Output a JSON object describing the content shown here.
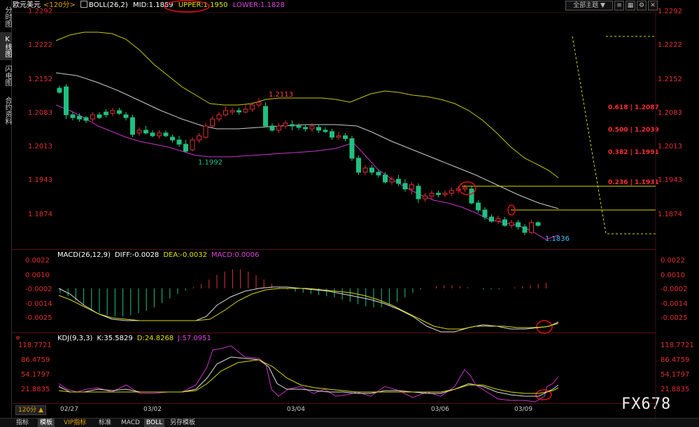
{
  "sidebar": {
    "items": [
      {
        "label": "分时图",
        "active": false
      },
      {
        "label": "K线图",
        "active": true
      },
      {
        "label": "闪电图",
        "active": false
      },
      {
        "label": "合约资料",
        "active": false
      }
    ]
  },
  "header": {
    "symbol": "欧元美元",
    "period": "<120分>",
    "boll_label": "BOLL(26,2)",
    "mid": "MID:1.1889",
    "upper": "UPPER:1.1950",
    "lower": "LOWER:1.1828",
    "theme_button": "全部主题",
    "theme_arrow": "▼"
  },
  "colors": {
    "upper_band": "#c8c800",
    "mid_band": "#cccccc",
    "lower_band": "#cc33cc",
    "up_candle": "#e03030",
    "down_candle": "#20c080",
    "axis_text": "#e03030",
    "fib_text": "#ff3030",
    "annotation_circle": "#e01010"
  },
  "price_axis": [
    "1.2292",
    "1.2222",
    "1.2152",
    "1.2083",
    "1.2013",
    "1.1943",
    "1.1874"
  ],
  "price_annotations": {
    "high": "1.2113",
    "low1": "1.1992",
    "low2": "1.1836"
  },
  "fibonacci": [
    {
      "label": "0.618 | 1.2087"
    },
    {
      "label": "0.500 | 1.2039"
    },
    {
      "label": "0.382 | 1.1991"
    },
    {
      "label": "0.236 | 1.1931"
    }
  ],
  "macd": {
    "title": "MACD(26,12,9)",
    "diff": "DIFF:-0.0028",
    "dea": "DEA:-0.0032",
    "macd": "MACD:0.0006",
    "axis": [
      "0.0022",
      "0.0010",
      "-0.0002",
      "-0.0014",
      "-0.0025"
    ]
  },
  "kdj": {
    "title": "KDJ(9,3,3)",
    "k": "K:35.5829",
    "d": "D:24.8268",
    "j": "J:57.0951",
    "axis": [
      "118.7721",
      "86.4759",
      "54.1797",
      "21.8835"
    ]
  },
  "dates": [
    "02/27",
    "03/02",
    "03/04",
    "03/06",
    "03/09"
  ],
  "period_selector": "120分",
  "watermark": "FX678",
  "bottom_tabs": [
    {
      "label": "指标",
      "active": false
    },
    {
      "label": "模板",
      "active": true
    },
    {
      "label": "VIP指标",
      "active": false
    },
    {
      "label": "标准",
      "active": false
    },
    {
      "label": "MACD",
      "active": false
    },
    {
      "label": "BOLL",
      "active": true
    },
    {
      "label": "另存模板",
      "active": false
    }
  ]
}
